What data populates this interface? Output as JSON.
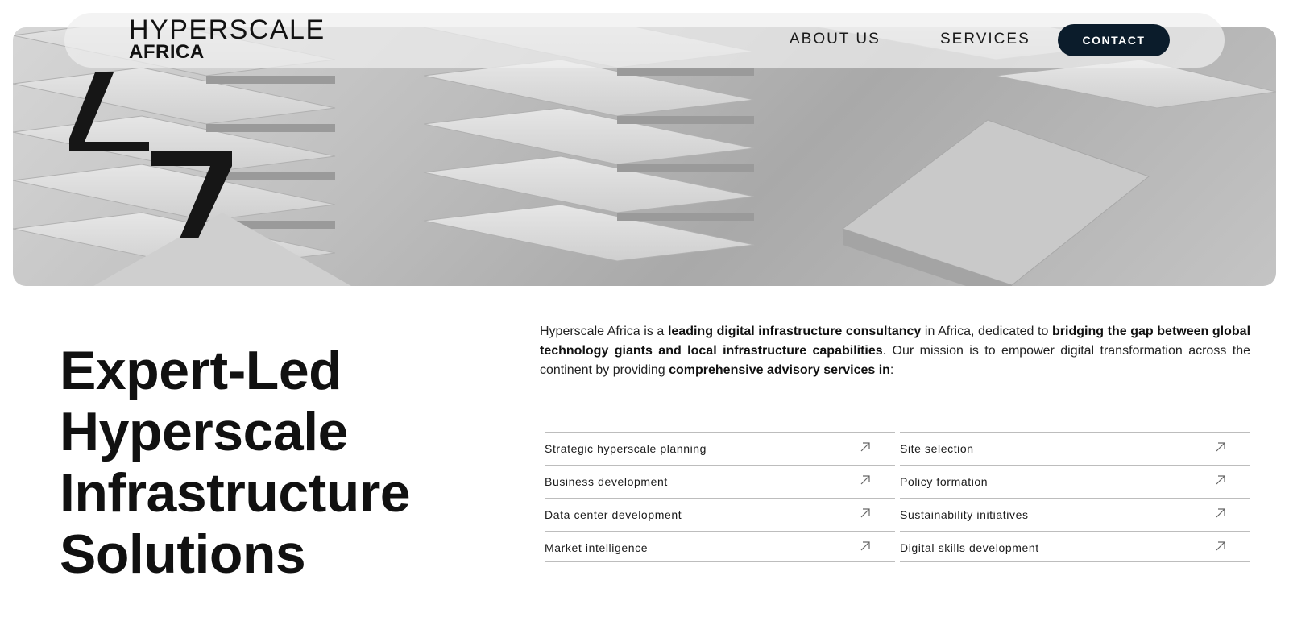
{
  "brand": {
    "logo_top": "HYPERSCALE",
    "logo_bottom": "AFRICA"
  },
  "nav": {
    "about_label": "ABOUT US",
    "services_label": "SERVICES",
    "contact_label": "CONTACT"
  },
  "headline": {
    "line1": "Expert-Led",
    "line2": "Hyperscale",
    "line3": "Infrastructure",
    "line4": "Solutions"
  },
  "intro": {
    "p1": "Hyperscale Africa is a ",
    "b1": "leading digital infrastructure consultancy",
    "p2": " in Africa, dedicated to ",
    "b2": "bridging the gap between global technology giants and local infrastructure capabilities",
    "p3": ". Our mission is to empower digital transformation across the continent by providing ",
    "b3": "comprehensive advisory services in",
    "p4": ":"
  },
  "services_left": [
    {
      "label": "Strategic hyperscale planning"
    },
    {
      "label": "Business development"
    },
    {
      "label": "Data center development"
    },
    {
      "label": "Market intelligence"
    }
  ],
  "services_right": [
    {
      "label": "Site selection"
    },
    {
      "label": "Policy formation"
    },
    {
      "label": "Sustainability initiatives"
    },
    {
      "label": "Digital skills development"
    }
  ],
  "colors": {
    "contact_bg": "#0b1c2b",
    "hero_tone": "#bdbdbd"
  }
}
